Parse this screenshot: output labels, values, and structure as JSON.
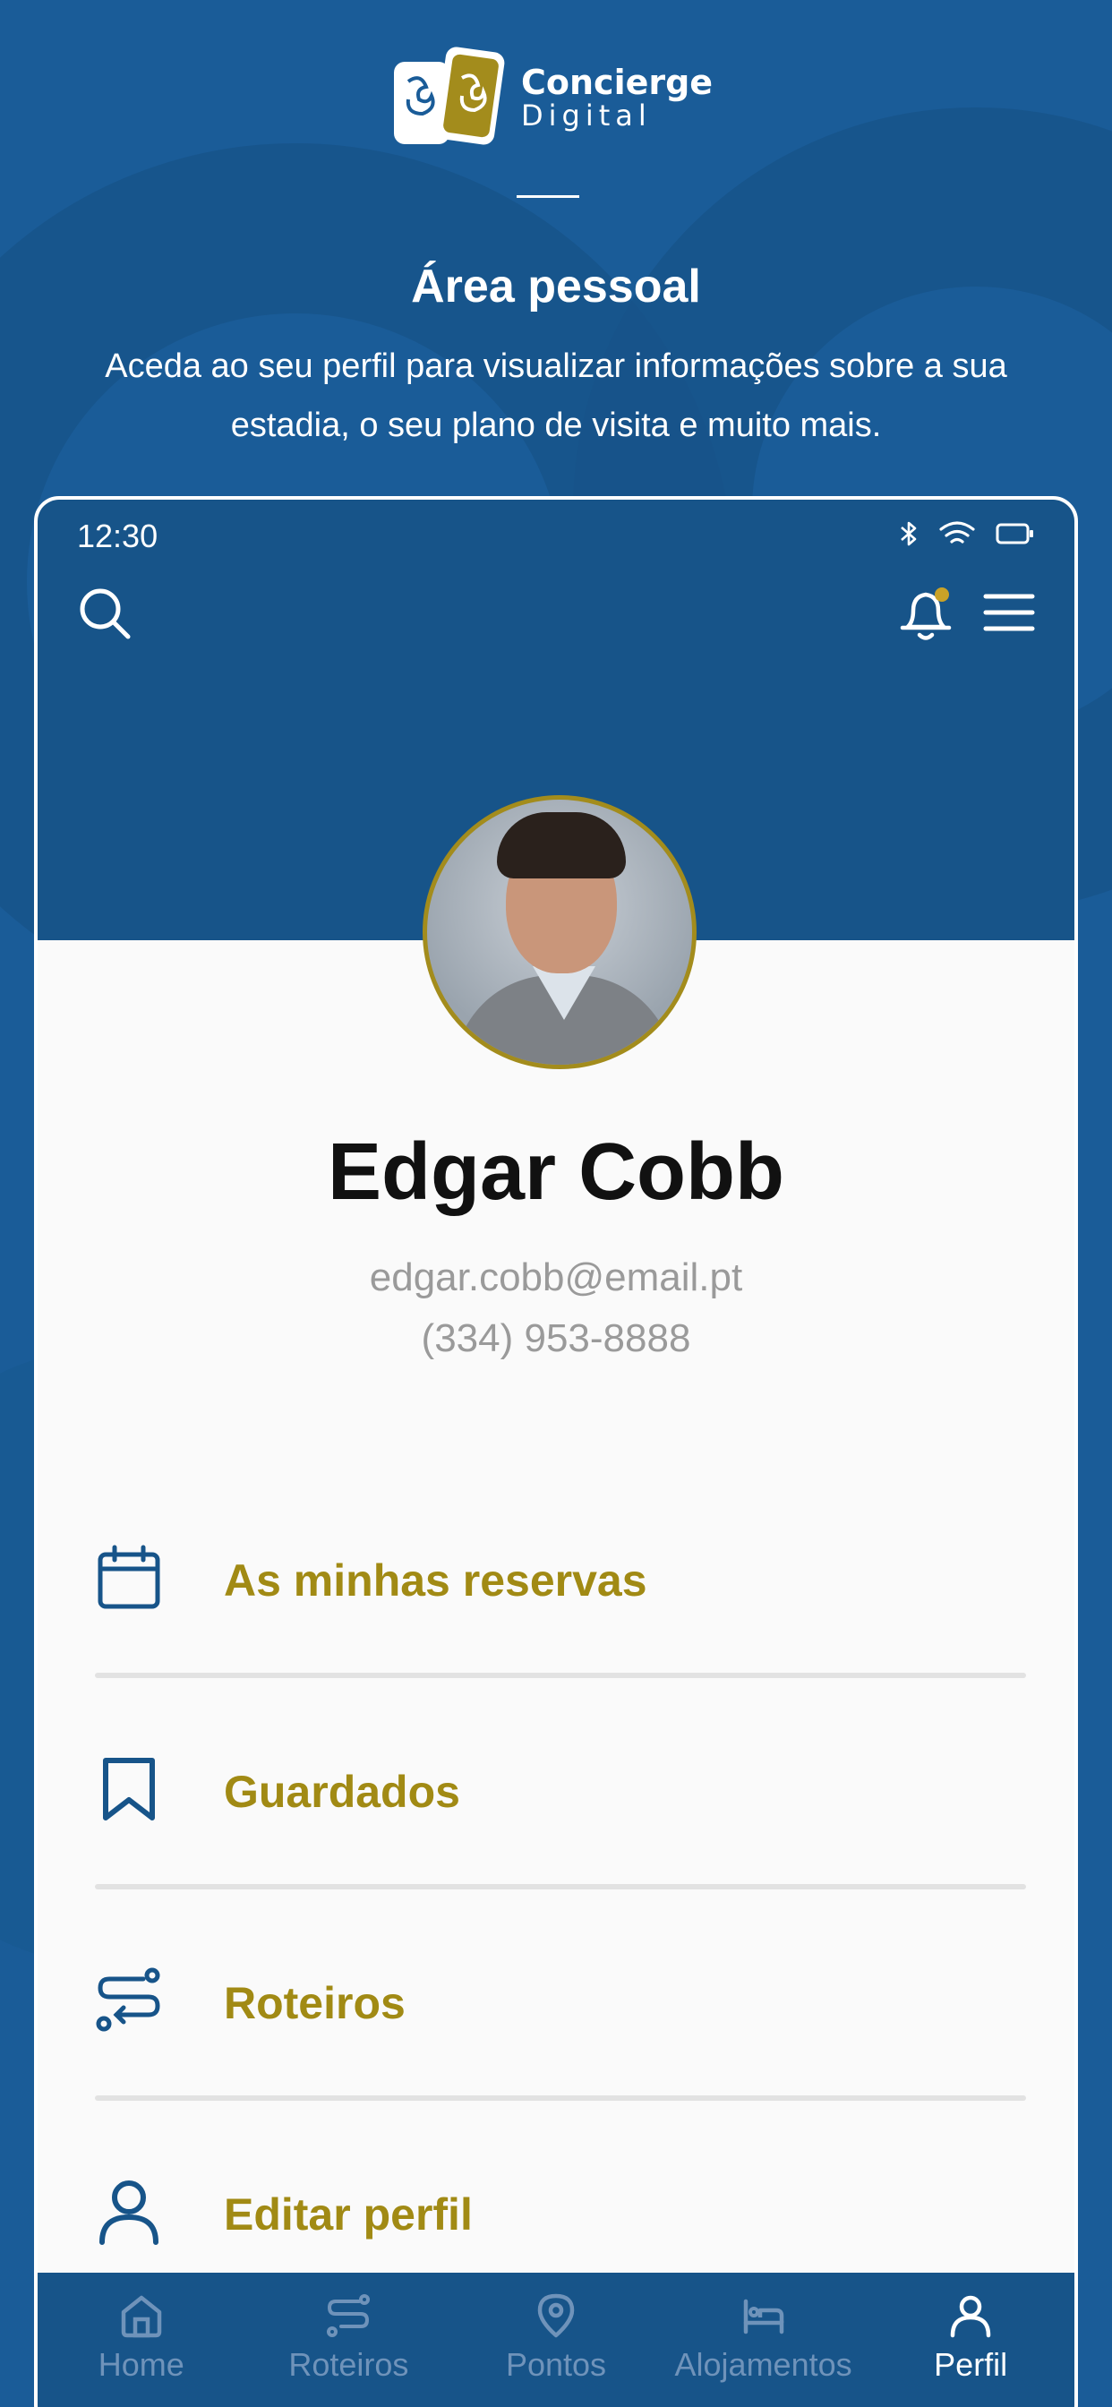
{
  "brand": {
    "line1": "Concierge",
    "line2": "Digital"
  },
  "hero": {
    "title": "Área pessoal",
    "description": "Aceda ao seu perfil para visualizar informações sobre a sua estadia, o seu plano de visita e muito mais."
  },
  "status_bar": {
    "time": "12:30"
  },
  "profile": {
    "name": "Edgar Cobb",
    "email": "edgar.cobb@email.pt",
    "phone": "(334) 953-8888"
  },
  "menu": [
    {
      "label": "As minhas reservas",
      "icon": "calendar-icon"
    },
    {
      "label": "Guardados",
      "icon": "bookmark-icon"
    },
    {
      "label": "Roteiros",
      "icon": "route-icon"
    },
    {
      "label": "Editar perfil",
      "icon": "user-icon"
    }
  ],
  "tabs": [
    {
      "label": "Home",
      "icon": "home-icon",
      "active": false
    },
    {
      "label": "Roteiros",
      "icon": "route-icon",
      "active": false
    },
    {
      "label": "Pontos",
      "icon": "map-pin-icon",
      "active": false
    },
    {
      "label": "Alojamentos",
      "icon": "bed-icon",
      "active": false
    },
    {
      "label": "Perfil",
      "icon": "user-icon",
      "active": true
    }
  ],
  "colors": {
    "primary_blue": "#175489",
    "accent_gold": "#a18a14",
    "notification_dot": "#c9a227"
  }
}
